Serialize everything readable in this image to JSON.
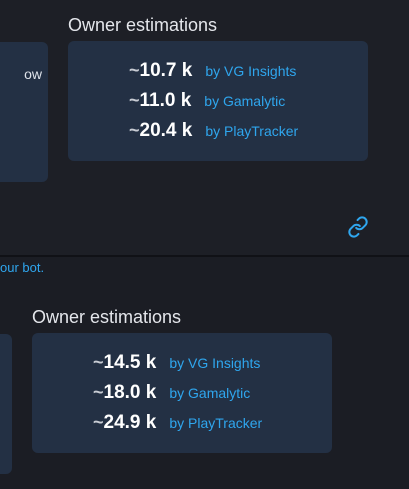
{
  "colors": {
    "background": "#1b1d24",
    "card": "#233044",
    "accent": "#2fa6ee",
    "value_text": "#ffffff",
    "title_text": "#e4e6eb"
  },
  "embeds": [
    {
      "side_card_text": "ow",
      "section_title": "Owner estimations",
      "estimates": [
        {
          "prefix": "~",
          "value": "10.7 k",
          "source": "by VG Insights"
        },
        {
          "prefix": "~",
          "value": "11.0 k",
          "source": "by Gamalytic"
        },
        {
          "prefix": "~",
          "value": "20.4 k",
          "source": "by PlayTracker"
        }
      ],
      "link_icon": "link-icon"
    },
    {
      "section_title": "Owner estimations",
      "estimates": [
        {
          "prefix": "~",
          "value": "14.5 k",
          "source": "by VG Insights"
        },
        {
          "prefix": "~",
          "value": "18.0 k",
          "source": "by Gamalytic"
        },
        {
          "prefix": "~",
          "value": "24.9 k",
          "source": "by PlayTracker"
        }
      ]
    }
  ],
  "footer_text": "our bot."
}
